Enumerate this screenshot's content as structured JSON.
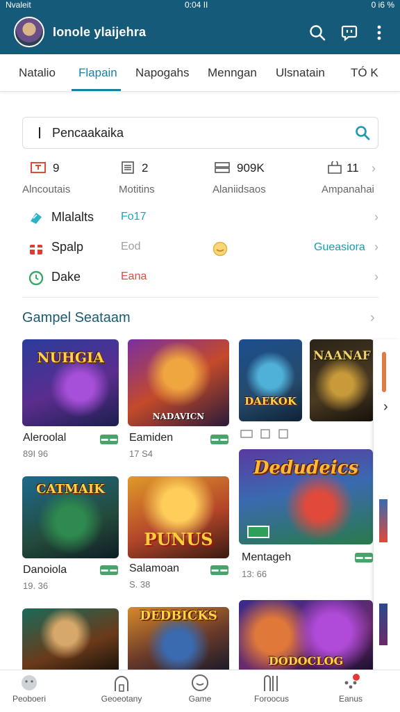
{
  "status_bar": {
    "left": "Nvaleit",
    "center": "0:04 II",
    "right": "0 i6 %"
  },
  "app_bar": {
    "title": "Ionole ylaijehra",
    "icons": [
      "search-icon",
      "chat-icon",
      "more-vertical-icon"
    ]
  },
  "tabs": [
    {
      "label": "Natalio",
      "active": false
    },
    {
      "label": "Flapain",
      "active": true
    },
    {
      "label": "Napogahs",
      "active": false
    },
    {
      "label": "Menngan",
      "active": false
    },
    {
      "label": "Ulsnatain",
      "active": false
    },
    {
      "label": "TÓ K",
      "active": false
    }
  ],
  "search": {
    "value": "Pencaakaika",
    "icon": "search-icon"
  },
  "stats": [
    {
      "icon": "tv-icon",
      "value": "9",
      "label": "Alncoutais"
    },
    {
      "icon": "list-icon",
      "value": "2",
      "label": "Motitins"
    },
    {
      "icon": "server-icon",
      "value": "909K",
      "label": "Alaniidsaos"
    },
    {
      "icon": "bag-icon",
      "value": "11",
      "label": "Ampanahai"
    }
  ],
  "rows": [
    {
      "icon": "gem-icon",
      "name": "Mlalalts",
      "value": "Fo17",
      "value_color": "#1aa6b5",
      "extra": "",
      "extra_icon": ""
    },
    {
      "icon": "gift-icon",
      "name": "Spalp",
      "value": "Eod",
      "value_color": "#9aa0a6",
      "extra": "Gueasiora",
      "extra_icon": "coin-icon"
    },
    {
      "icon": "clock-icon",
      "name": "Dake",
      "value": "Eana",
      "value_color": "#e04a3a",
      "extra": "",
      "extra_icon": ""
    }
  ],
  "section": {
    "title": "Gampel Seataam"
  },
  "games": [
    {
      "art_text": "NUHGIA",
      "name": "Aleroolal",
      "sub": "89I 96",
      "badge": "▬ ▬"
    },
    {
      "art_text": "NADAVICN",
      "name": "Eamiden",
      "sub": "17 S4",
      "badge": "▬ ▬"
    },
    {
      "art_text": "DAEKOK",
      "name": "",
      "sub": "",
      "badge": ""
    },
    {
      "art_text": "NAANAF",
      "name": "",
      "sub": "",
      "badge": ""
    },
    {
      "art_text": "CATMAIK",
      "name": "Danoiola",
      "sub": "19. 36",
      "badge": "▬ ▬"
    },
    {
      "art_text": "PUNUS",
      "name": "Salamoan",
      "sub": "S. 38",
      "badge": "▬ ▬"
    },
    {
      "art_text": "Dedudeics",
      "name": "Mentageh",
      "sub": "13: 66",
      "badge": "▬ ▬"
    },
    {
      "art_text": "",
      "name": "",
      "sub": "",
      "badge": ""
    },
    {
      "art_text": "DEDBICKS",
      "name": "",
      "sub": "",
      "badge": ""
    },
    {
      "art_text": "DODOCLOG",
      "name": "",
      "sub": "",
      "badge": ""
    }
  ],
  "bottom_nav": [
    {
      "label": "Peoboeri",
      "icon": "face-icon"
    },
    {
      "label": "Geoeotany",
      "icon": "home-icon"
    },
    {
      "label": "Game",
      "icon": "gamepad-icon"
    },
    {
      "label": "Foroocus",
      "icon": "columns-icon"
    },
    {
      "label": "Eanus",
      "icon": "dots-icon",
      "notification": true
    }
  ],
  "colors": {
    "primary": "#155a78",
    "accent": "#1a7fa0",
    "badge_green": "#4aa36a",
    "notification_red": "#e53935"
  }
}
